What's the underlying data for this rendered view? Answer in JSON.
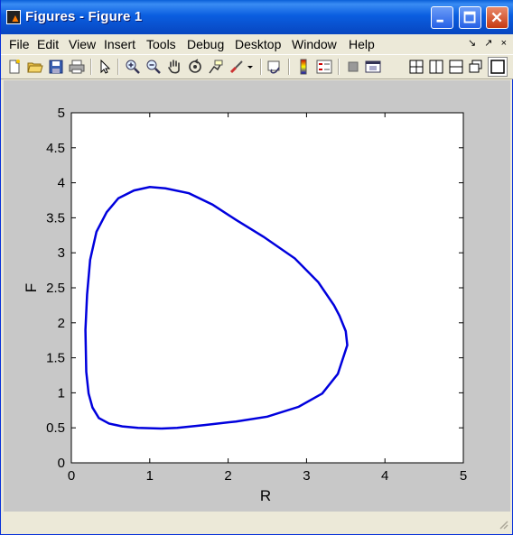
{
  "window": {
    "title": "Figures - Figure 1"
  },
  "menu": [
    "File",
    "Edit",
    "View",
    "Insert",
    "Tools",
    "Debug",
    "Desktop",
    "Window",
    "Help"
  ],
  "dock_controls": [
    "↘",
    "↗",
    "×"
  ],
  "toolbar": {
    "tools": [
      "new-figure-icon",
      "open-file-icon",
      "save-icon",
      "print-icon",
      "pointer-icon",
      "zoom-in-icon",
      "zoom-out-icon",
      "pan-hand-icon",
      "rotate-3d-icon",
      "data-cursor-icon",
      "brush-icon",
      "brush-dropdown-icon",
      "link-plot-icon",
      "colorbar-icon",
      "legend-icon",
      "hide-plot-tools-icon",
      "show-plot-tools-icon"
    ],
    "layout_tools": [
      "tile-grid-icon",
      "tile-columns-icon",
      "tile-rows-icon",
      "float-icon",
      "maximize-icon"
    ]
  },
  "chart_data": {
    "type": "line",
    "title": "",
    "xlabel": "R",
    "ylabel": "F",
    "xlim": [
      0,
      5
    ],
    "ylim": [
      0,
      5
    ],
    "xticks": [
      "0",
      "1",
      "2",
      "3",
      "4",
      "5"
    ],
    "yticks": [
      "0",
      "0.5",
      "1",
      "1.5",
      "2",
      "2.5",
      "3",
      "3.5",
      "4",
      "4.5",
      "5"
    ],
    "grid": false,
    "color": "#0000dd",
    "series": [
      {
        "x": [
          1.15,
          1.35,
          1.7,
          2.1,
          2.5,
          2.9,
          3.2,
          3.4,
          3.52,
          3.5,
          3.42,
          3.35,
          3.15,
          2.85,
          2.45,
          2.1,
          1.8,
          1.5,
          1.2,
          1.0,
          0.8,
          0.6,
          0.45,
          0.32,
          0.24,
          0.2,
          0.18,
          0.19,
          0.22,
          0.27,
          0.35,
          0.48,
          0.65,
          0.85,
          1.15
        ],
        "y": [
          0.49,
          0.5,
          0.54,
          0.59,
          0.66,
          0.8,
          0.99,
          1.27,
          1.68,
          1.88,
          2.1,
          2.25,
          2.58,
          2.92,
          3.23,
          3.47,
          3.69,
          3.85,
          3.92,
          3.94,
          3.89,
          3.78,
          3.58,
          3.3,
          2.9,
          2.4,
          1.9,
          1.3,
          0.99,
          0.79,
          0.64,
          0.56,
          0.52,
          0.5,
          0.49
        ]
      }
    ]
  }
}
